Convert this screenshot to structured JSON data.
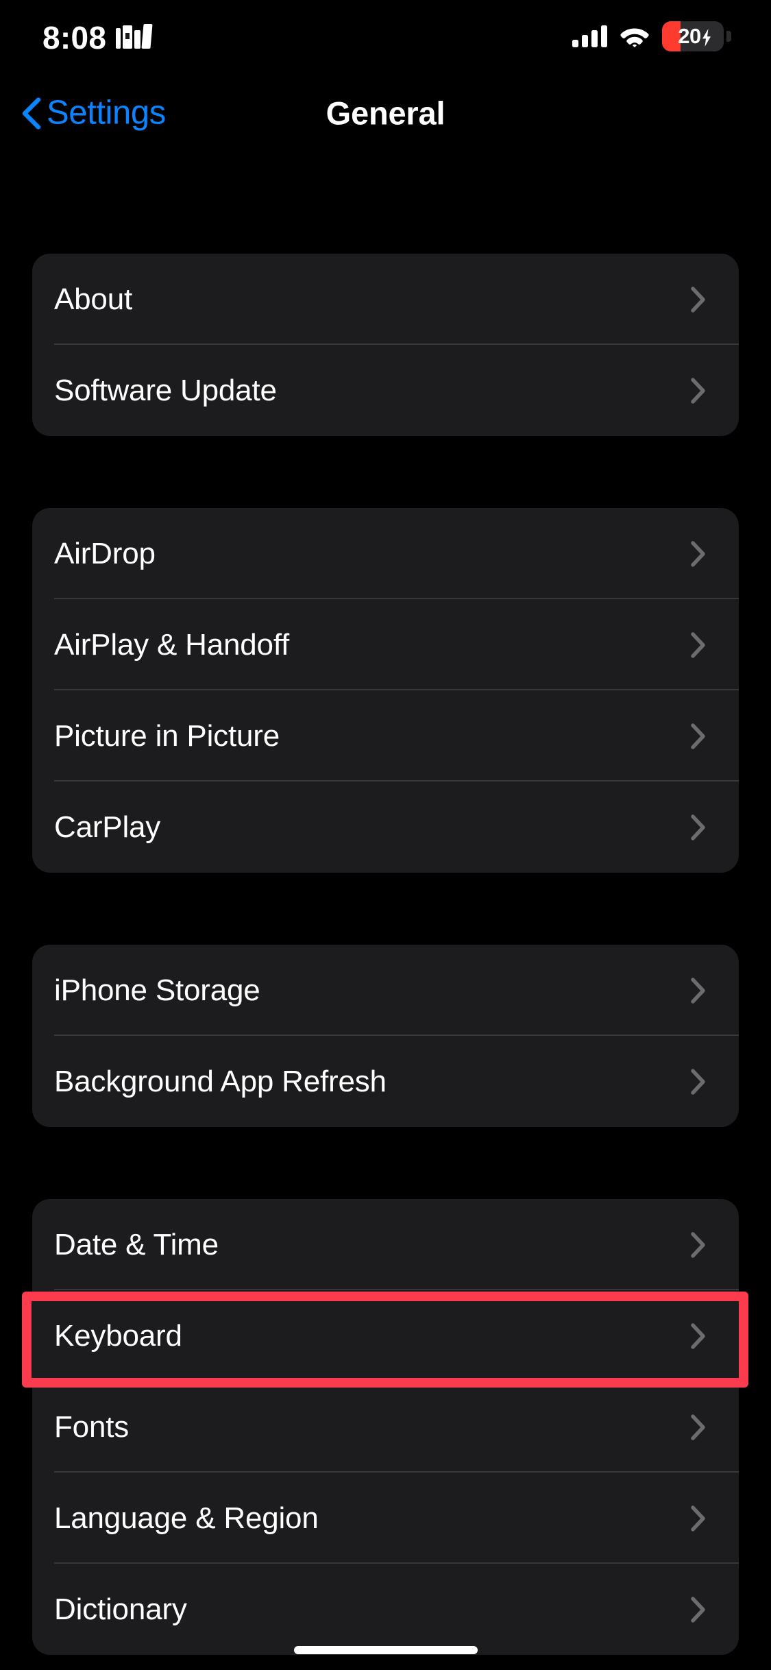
{
  "status_bar": {
    "time": "8:08",
    "books_icon": "books-icon",
    "cellular_icon": "cellular-signal-icon",
    "cellular_bars": 4,
    "wifi_icon": "wifi-icon",
    "battery": {
      "percent_label": "20",
      "percent_value": 20,
      "charging": true,
      "fill_color": "#FF3B30",
      "body_color": "#2C2C2E",
      "bolt_icon": "charging-bolt-icon"
    }
  },
  "nav_bar": {
    "back_icon": "chevron-left-icon",
    "back_label": "Settings",
    "title": "General",
    "back_color": "#0A84FF"
  },
  "colors": {
    "background": "#000000",
    "card": "#1C1C1E",
    "separator": "#38383A",
    "label": "#FFFFFF",
    "chevron": "#6C6C70",
    "accent_blue": "#0A84FF",
    "highlight_red": "#FA3C4E"
  },
  "highlight": {
    "target_row": "Keyboard",
    "group_index": 3,
    "row_index": 1,
    "color": "#FA3C4E",
    "border_width_px": 14
  },
  "groups": [
    {
      "id": "group-system",
      "rows": [
        {
          "label": "About",
          "chevron": "chevron-right-icon"
        },
        {
          "label": "Software Update",
          "chevron": "chevron-right-icon"
        }
      ]
    },
    {
      "id": "group-connectivity",
      "rows": [
        {
          "label": "AirDrop",
          "chevron": "chevron-right-icon"
        },
        {
          "label": "AirPlay & Handoff",
          "chevron": "chevron-right-icon"
        },
        {
          "label": "Picture in Picture",
          "chevron": "chevron-right-icon"
        },
        {
          "label": "CarPlay",
          "chevron": "chevron-right-icon"
        }
      ]
    },
    {
      "id": "group-storage",
      "rows": [
        {
          "label": "iPhone Storage",
          "chevron": "chevron-right-icon"
        },
        {
          "label": "Background App Refresh",
          "chevron": "chevron-right-icon"
        }
      ]
    },
    {
      "id": "group-input",
      "rows": [
        {
          "label": "Date & Time",
          "chevron": "chevron-right-icon"
        },
        {
          "label": "Keyboard",
          "chevron": "chevron-right-icon"
        },
        {
          "label": "Fonts",
          "chevron": "chevron-right-icon"
        },
        {
          "label": "Language & Region",
          "chevron": "chevron-right-icon"
        },
        {
          "label": "Dictionary",
          "chevron": "chevron-right-icon"
        }
      ]
    }
  ],
  "home_indicator": "home-indicator"
}
